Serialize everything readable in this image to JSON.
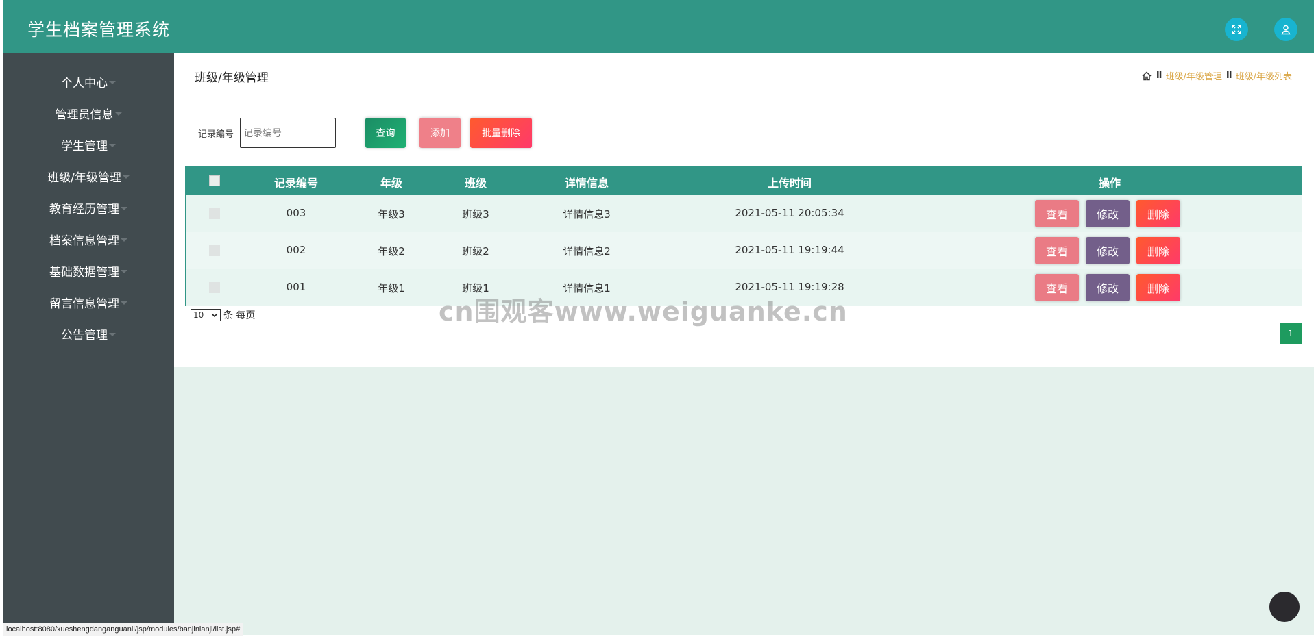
{
  "header": {
    "title": "学生档案管理系统"
  },
  "sidebar": {
    "items": [
      {
        "label": "个人中心"
      },
      {
        "label": "管理员信息"
      },
      {
        "label": "学生管理"
      },
      {
        "label": "班级/年级管理"
      },
      {
        "label": "教育经历管理"
      },
      {
        "label": "档案信息管理"
      },
      {
        "label": "基础数据管理"
      },
      {
        "label": "留言信息管理"
      },
      {
        "label": "公告管理"
      }
    ]
  },
  "page": {
    "title": "班级/年级管理",
    "breadcrumb": {
      "sep": "II",
      "level1": "班级/年级管理",
      "level2": "班级/年级列表"
    }
  },
  "search": {
    "label": "记录编号",
    "placeholder": "记录编号",
    "query_label": "查询",
    "add_label": "添加",
    "batch_delete_label": "批量删除"
  },
  "table": {
    "headers": {
      "id": "记录编号",
      "grade": "年级",
      "class": "班级",
      "detail": "详情信息",
      "time": "上传时间",
      "ops": "操作"
    },
    "rows": [
      {
        "id": "003",
        "grade": "年级3",
        "class": "班级3",
        "detail": "详情信息3",
        "time": "2021-05-11 20:05:34"
      },
      {
        "id": "002",
        "grade": "年级2",
        "class": "班级2",
        "detail": "详情信息2",
        "time": "2021-05-11 19:19:44"
      },
      {
        "id": "001",
        "grade": "年级1",
        "class": "班级1",
        "detail": "详情信息1",
        "time": "2021-05-11 19:19:28"
      }
    ],
    "actions": {
      "view": "查看",
      "edit": "修改",
      "delete": "删除"
    }
  },
  "pagination": {
    "page_size": "10",
    "per_page_label": "条 每页",
    "current_page": "1"
  },
  "watermark": "cn围观客www.weiguanke.cn",
  "status_bar": "localhost:8080/xueshengdanganguanli/jsp/modules/banjinianji/list.jsp#",
  "colors": {
    "header": "#319686",
    "sidebar": "#414b4f",
    "accent_gold": "#d9a441",
    "edit": "#735f8a",
    "view": "#ea7b85",
    "delete": "#ff4b3a"
  }
}
